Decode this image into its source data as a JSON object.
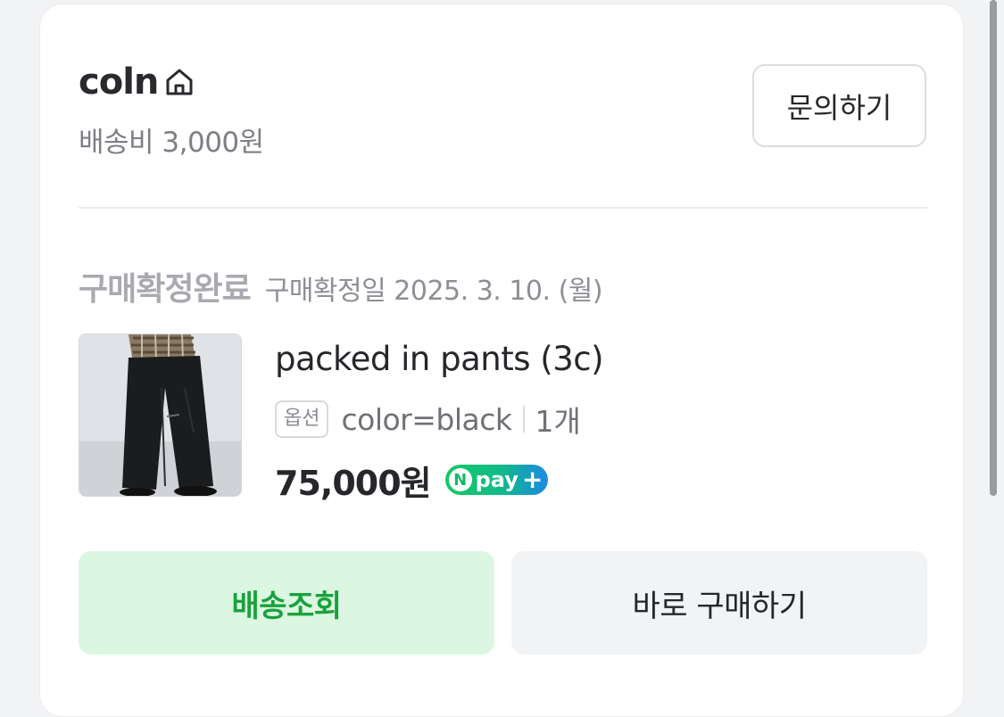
{
  "store": {
    "name": "coln",
    "home_icon": "home-icon",
    "shipping_fee": "배송비 3,000원",
    "inquiry_label": "문의하기"
  },
  "order": {
    "status_label": "구매확정완료",
    "status_date": "구매확정일 2025. 3. 10. (월)"
  },
  "product": {
    "name": "packed in pants (3c)",
    "option_badge": "옵션",
    "option_value": "color=black",
    "quantity": "1개",
    "price": "75,000원",
    "npay_letter": "N",
    "npay_text": "pay",
    "npay_plus": "+"
  },
  "actions": {
    "track_label": "배송조회",
    "buy_again_label": "바로 구매하기"
  },
  "colors": {
    "accent_green": "#19a23d",
    "accent_green_bg": "#dcf7e1",
    "npay_green": "#18c964",
    "npay_blue": "#1e88e5"
  }
}
